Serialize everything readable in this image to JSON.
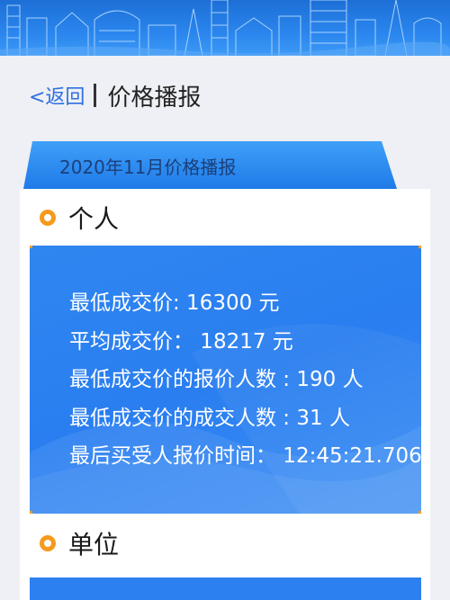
{
  "header": {
    "back_label": "<返回",
    "title": "价格播报"
  },
  "ribbon": {
    "label": "2020年11月价格播报"
  },
  "sections": [
    {
      "label": "个人"
    },
    {
      "label": "单位"
    }
  ],
  "personal_card": {
    "lines": [
      "最低成交价: 16300 元",
      "平均成交价： 18217 元",
      "最低成交价的报价人数 : 190 人",
      "最低成交价的成交人数 : 31 人",
      "最后买受人报价时间： 12:45:21.706"
    ]
  },
  "colors": {
    "accent_blue": "#2a7ef0",
    "bullet_orange": "#f59a1d",
    "link_blue": "#2f6fe0"
  }
}
